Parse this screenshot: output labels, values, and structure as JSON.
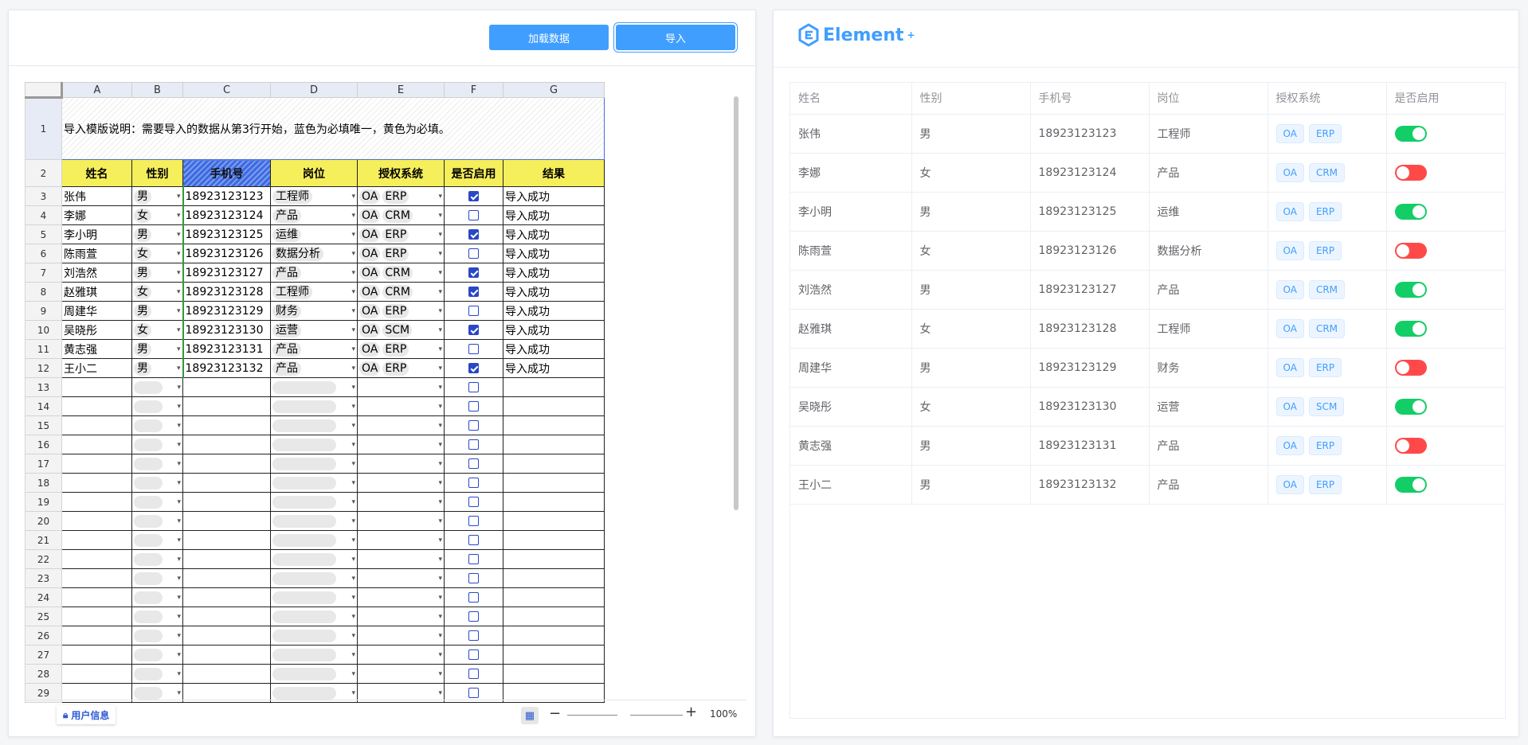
{
  "toolbar": {
    "load_label": "加载数据",
    "import_label": "导入"
  },
  "sheet": {
    "columns": [
      "A",
      "B",
      "C",
      "D",
      "E",
      "F",
      "G"
    ],
    "instruction": "导入模版说明：需要导入的数据从第3行开始，蓝色为必填唯一，黄色为必填。",
    "headers": [
      "姓名",
      "性别",
      "手机号",
      "岗位",
      "授权系统",
      "是否启用",
      "结果"
    ],
    "rows": [
      {
        "name": "张伟",
        "gender": "男",
        "phone": "18923123123",
        "post": "工程师",
        "systems": [
          "OA",
          "ERP"
        ],
        "enabled": true,
        "result": "导入成功"
      },
      {
        "name": "李娜",
        "gender": "女",
        "phone": "18923123124",
        "post": "产品",
        "systems": [
          "OA",
          "CRM"
        ],
        "enabled": false,
        "result": "导入成功"
      },
      {
        "name": "李小明",
        "gender": "男",
        "phone": "18923123125",
        "post": "运维",
        "systems": [
          "OA",
          "ERP"
        ],
        "enabled": true,
        "result": "导入成功"
      },
      {
        "name": "陈雨萱",
        "gender": "女",
        "phone": "18923123126",
        "post": "数据分析",
        "systems": [
          "OA",
          "ERP"
        ],
        "enabled": false,
        "result": "导入成功"
      },
      {
        "name": "刘浩然",
        "gender": "男",
        "phone": "18923123127",
        "post": "产品",
        "systems": [
          "OA",
          "CRM"
        ],
        "enabled": true,
        "result": "导入成功"
      },
      {
        "name": "赵雅琪",
        "gender": "女",
        "phone": "18923123128",
        "post": "工程师",
        "systems": [
          "OA",
          "CRM"
        ],
        "enabled": true,
        "result": "导入成功"
      },
      {
        "name": "周建华",
        "gender": "男",
        "phone": "18923123129",
        "post": "财务",
        "systems": [
          "OA",
          "ERP"
        ],
        "enabled": false,
        "result": "导入成功"
      },
      {
        "name": "吴晓彤",
        "gender": "女",
        "phone": "18923123130",
        "post": "运营",
        "systems": [
          "OA",
          "SCM"
        ],
        "enabled": true,
        "result": "导入成功"
      },
      {
        "name": "黄志强",
        "gender": "男",
        "phone": "18923123131",
        "post": "产品",
        "systems": [
          "OA",
          "ERP"
        ],
        "enabled": false,
        "result": "导入成功"
      },
      {
        "name": "王小二",
        "gender": "男",
        "phone": "18923123132",
        "post": "产品",
        "systems": [
          "OA",
          "ERP"
        ],
        "enabled": true,
        "result": "导入成功"
      }
    ],
    "empty_rows": [
      13,
      14,
      15,
      16,
      17,
      18,
      19,
      20,
      21,
      22,
      23,
      24,
      25,
      26,
      27,
      28,
      29
    ],
    "sheet_tab_label": "用户信息",
    "zoom_label": "100%"
  },
  "element_panel": {
    "logo_text": "Element",
    "logo_sup": "+",
    "headers": [
      "姓名",
      "性别",
      "手机号",
      "岗位",
      "授权系统",
      "是否启用"
    ],
    "rows": [
      {
        "name": "张伟",
        "gender": "男",
        "phone": "18923123123",
        "post": "工程师",
        "systems": [
          "OA",
          "ERP"
        ],
        "enabled": true
      },
      {
        "name": "李娜",
        "gender": "女",
        "phone": "18923123124",
        "post": "产品",
        "systems": [
          "OA",
          "CRM"
        ],
        "enabled": false
      },
      {
        "name": "李小明",
        "gender": "男",
        "phone": "18923123125",
        "post": "运维",
        "systems": [
          "OA",
          "ERP"
        ],
        "enabled": true
      },
      {
        "name": "陈雨萱",
        "gender": "女",
        "phone": "18923123126",
        "post": "数据分析",
        "systems": [
          "OA",
          "ERP"
        ],
        "enabled": false
      },
      {
        "name": "刘浩然",
        "gender": "男",
        "phone": "18923123127",
        "post": "产品",
        "systems": [
          "OA",
          "CRM"
        ],
        "enabled": true
      },
      {
        "name": "赵雅琪",
        "gender": "女",
        "phone": "18923123128",
        "post": "工程师",
        "systems": [
          "OA",
          "CRM"
        ],
        "enabled": true
      },
      {
        "name": "周建华",
        "gender": "男",
        "phone": "18923123129",
        "post": "财务",
        "systems": [
          "OA",
          "ERP"
        ],
        "enabled": false
      },
      {
        "name": "吴晓彤",
        "gender": "女",
        "phone": "18923123130",
        "post": "运营",
        "systems": [
          "OA",
          "SCM"
        ],
        "enabled": true
      },
      {
        "name": "黄志强",
        "gender": "男",
        "phone": "18923123131",
        "post": "产品",
        "systems": [
          "OA",
          "ERP"
        ],
        "enabled": false
      },
      {
        "name": "王小二",
        "gender": "男",
        "phone": "18923123132",
        "post": "产品",
        "systems": [
          "OA",
          "ERP"
        ],
        "enabled": true
      }
    ]
  },
  "colors": {
    "primary": "#409eff",
    "switch_on": "#13ce66",
    "switch_off": "#ff4949",
    "required_yellow": "#f6ef5c",
    "unique_blue": "#3c6be0"
  }
}
